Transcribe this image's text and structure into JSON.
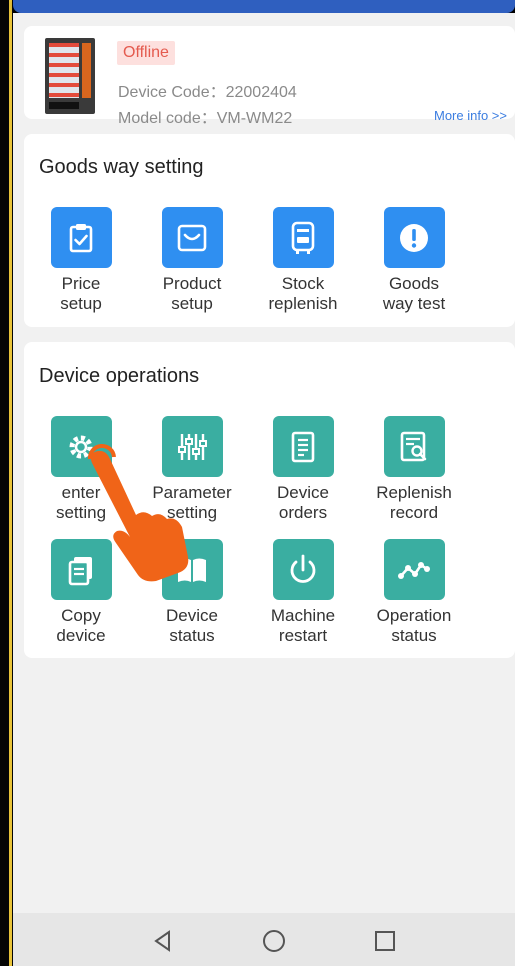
{
  "device": {
    "status": "Offline",
    "device_code": "Device Code：22002404",
    "model_code": "Model code：VM-WM22",
    "more_info": "More info >>"
  },
  "goods_way": {
    "title": "Goods way setting",
    "items": [
      {
        "label": "Price\nsetup",
        "icon": "clipboard-check-icon"
      },
      {
        "label": "Product\nsetup",
        "icon": "product-box-icon"
      },
      {
        "label": "Stock\nreplenish",
        "icon": "vending-unit-icon"
      },
      {
        "label": "Goods\nway test",
        "icon": "exclamation-icon"
      }
    ]
  },
  "device_ops": {
    "title": "Device operations",
    "items": [
      {
        "label": "enter\nsetting",
        "icon": "gear-icon"
      },
      {
        "label": "Parameter\nsetting",
        "icon": "sliders-icon"
      },
      {
        "label": "Device\norders",
        "icon": "document-icon"
      },
      {
        "label": "Replenish\nrecord",
        "icon": "record-search-icon"
      },
      {
        "label": "Copy\ndevice",
        "icon": "copy-icon"
      },
      {
        "label": "Device\nstatus",
        "icon": "book-icon"
      },
      {
        "label": "Machine\nrestart",
        "icon": "power-icon"
      },
      {
        "label": "Operation\nstatus",
        "icon": "line-graph-icon"
      }
    ]
  },
  "colors": {
    "blue_icon": "#2f8ff1",
    "teal_icon": "#3aaea1",
    "offline_badge_bg": "#fde0de",
    "offline_badge_text": "#e45a4e",
    "link": "#3b7de0"
  },
  "nav": {
    "back": "back-triangle-icon",
    "home": "home-circle-icon",
    "recents": "recents-square-icon"
  }
}
